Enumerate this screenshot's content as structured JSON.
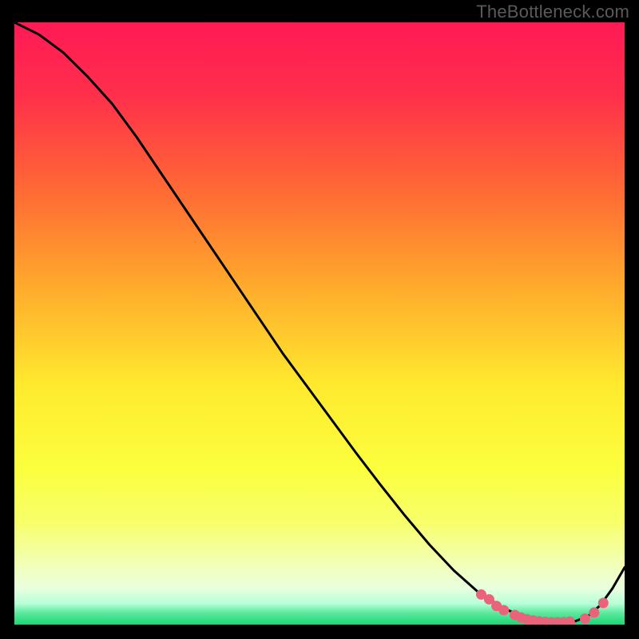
{
  "attribution": "TheBottleneck.com",
  "colors": {
    "background": "#000000",
    "gradient_top": "#ff1a55",
    "gradient_mid_upper": "#ff8a2a",
    "gradient_mid": "#ffe92e",
    "gradient_lower": "#f7ff6a",
    "gradient_pale": "#f3ffd0",
    "gradient_bottom": "#17d873",
    "curve": "#000000",
    "marker": "#e9637a"
  },
  "chart_data": {
    "type": "line",
    "title": "",
    "xlabel": "",
    "ylabel": "",
    "xlim": [
      0,
      100
    ],
    "ylim": [
      0,
      100
    ],
    "series": [
      {
        "name": "bottleneck-curve",
        "x": [
          0,
          4,
          8,
          12,
          16,
          20,
          24,
          28,
          32,
          36,
          40,
          44,
          48,
          52,
          56,
          60,
          64,
          68,
          72,
          76,
          80,
          82,
          84,
          86,
          88,
          90,
          92,
          94,
          96,
          98,
          100
        ],
        "y": [
          100,
          98,
          95,
          91,
          86.5,
          81,
          75,
          69,
          63,
          57,
          51,
          45,
          39.5,
          34,
          28.5,
          23.2,
          18.1,
          13.3,
          9.0,
          5.4,
          2.8,
          1.9,
          1.2,
          0.7,
          0.4,
          0.4,
          0.6,
          1.4,
          3.2,
          6.0,
          9.5
        ]
      }
    ],
    "markers": [
      {
        "x": 76.5,
        "y": 5.0
      },
      {
        "x": 77.8,
        "y": 4.2
      },
      {
        "x": 79.0,
        "y": 3.1
      },
      {
        "x": 80.2,
        "y": 2.4
      },
      {
        "x": 82.0,
        "y": 1.6
      },
      {
        "x": 83.0,
        "y": 1.2
      },
      {
        "x": 84.0,
        "y": 0.9
      },
      {
        "x": 85.0,
        "y": 0.7
      },
      {
        "x": 86.0,
        "y": 0.55
      },
      {
        "x": 87.0,
        "y": 0.45
      },
      {
        "x": 88.0,
        "y": 0.4
      },
      {
        "x": 89.0,
        "y": 0.4
      },
      {
        "x": 90.0,
        "y": 0.42
      },
      {
        "x": 91.0,
        "y": 0.5
      },
      {
        "x": 93.5,
        "y": 1.0
      },
      {
        "x": 95.0,
        "y": 2.0
      },
      {
        "x": 96.5,
        "y": 3.6
      }
    ]
  }
}
